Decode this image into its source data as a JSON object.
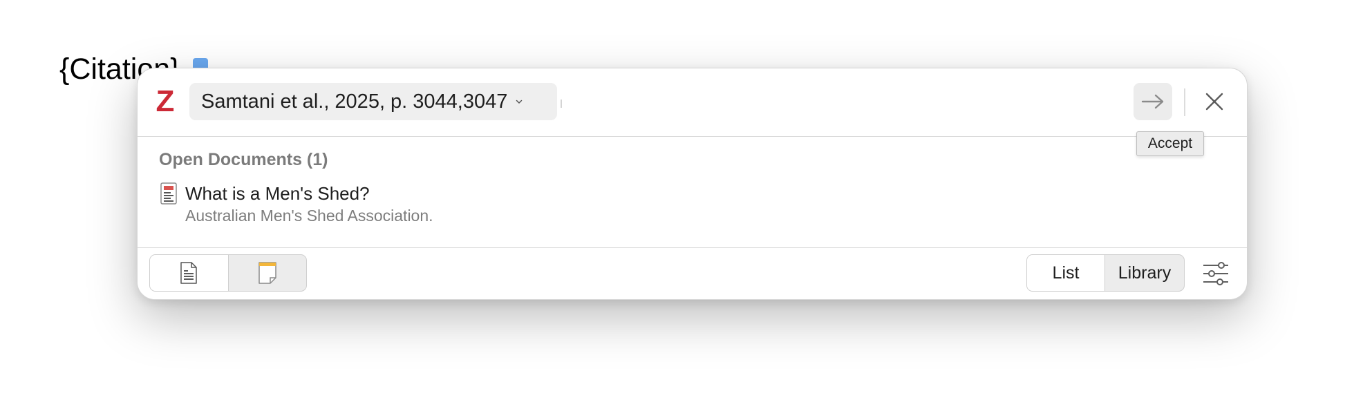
{
  "document": {
    "citation_placeholder": "{Citation}"
  },
  "dialog": {
    "logo_letter": "Z",
    "citation_bubble": {
      "label": "Samtani et al., 2025, p. 3044,3047"
    },
    "accept_tooltip": "Accept",
    "section": {
      "title": "Open Documents (1)",
      "items": [
        {
          "title": "What is a Men's Shed?",
          "subtitle": "Australian Men's Shed Association."
        }
      ]
    },
    "footer": {
      "view_options": [
        "List",
        "Library"
      ],
      "selected_view": "List"
    }
  },
  "colors": {
    "zotero_red": "#cc2936",
    "marker_blue": "#6aa8ef",
    "section_header_gray": "#7b7b7b",
    "note_yellow": "#f3b63a"
  },
  "icons": {
    "logo": "zotero-logo-icon",
    "chevron": "chevron-down-icon",
    "accept": "arrow-right-icon",
    "close": "close-icon",
    "item": "document-icon",
    "mode_citation": "document-lines-icon",
    "mode_note": "note-icon",
    "settings": "sliders-icon"
  }
}
